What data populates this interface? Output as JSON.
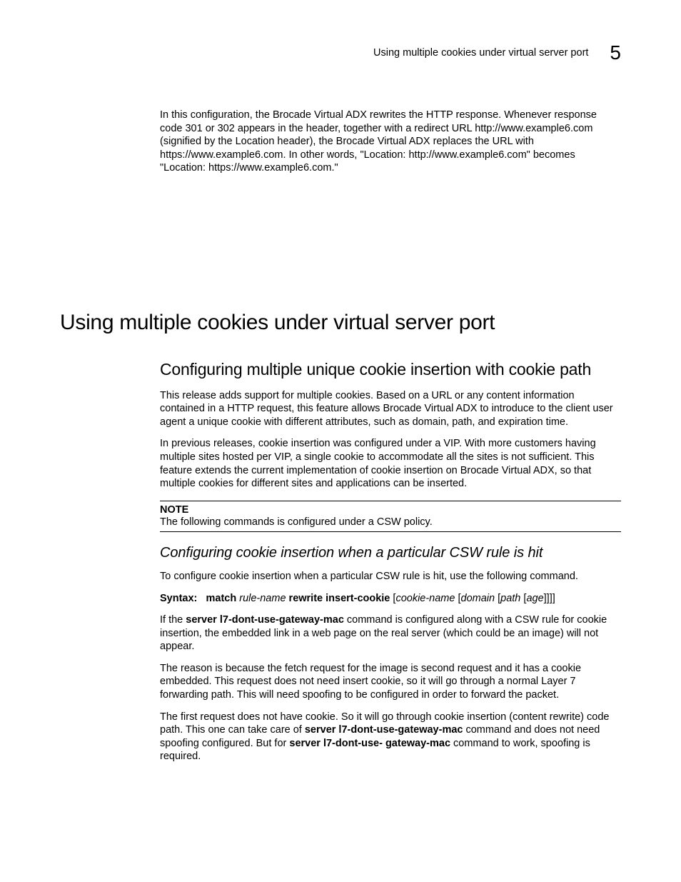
{
  "header": {
    "running_title": "Using multiple cookies under virtual server port",
    "chapter_number": "5"
  },
  "intro_para": "In this configuration, the Brocade Virtual ADX rewrites the HTTP response. Whenever response code 301 or 302 appears in the header, together with a redirect URL http://www.example6.com (signified by the Location header), the Brocade Virtual ADX replaces the URL with https://www.example6.com. In other words, \"Location: http://www.example6.com\" becomes \"Location: https://www.example6.com.\"",
  "h1": "Using multiple cookies under virtual server port",
  "h2": "Configuring multiple unique cookie insertion with cookie path",
  "p1": "This release adds support for multiple cookies. Based on a URL or any content information contained in a HTTP request, this feature allows Brocade Virtual ADX to introduce to the client user agent a unique cookie with different attributes, such as domain, path, and expiration time.",
  "p2": "In previous releases, cookie insertion was configured under a VIP. With more customers having multiple sites hosted per VIP, a single cookie to accommodate all the sites is not sufficient. This feature extends the current implementation of cookie insertion on Brocade Virtual ADX, so that multiple cookies for different sites and applications can be inserted.",
  "note": {
    "label": "NOTE",
    "text": "The following commands is configured under a CSW policy."
  },
  "h3": "Configuring cookie insertion when a particular CSW rule is hit",
  "p3": "To configure cookie insertion when a particular CSW rule is hit, use the following command.",
  "syntax": {
    "label": "Syntax:",
    "kw1": "match",
    "arg1": "rule-name",
    "kw2": "rewrite insert-cookie",
    "tail_open": " [",
    "arg2": "cookie-name",
    "tail_mid1": " [",
    "arg3": "domain",
    "tail_mid2": " [",
    "arg4": "path",
    "tail_mid3": " [",
    "arg5": "age",
    "tail_close": "]]]]"
  },
  "p4_pre": "If the ",
  "p4_cmd": "server l7-dont-use-gateway-mac",
  "p4_post": " command is configured along with a CSW rule for cookie insertion, the embedded link in a web page on the real server (which could be an image) will not appear.",
  "p5": "The reason is because the fetch request for the image is second request and it has a cookie embedded. This request does not need insert cookie, so it will go through a normal Layer 7 forwarding path. This will need spoofing to be configured in order to forward the packet.",
  "p6_a": "The first request does not have cookie. So it will go through cookie insertion (content rewrite) code path. This one can take care of ",
  "p6_cmd1": "server l7-dont-use-gateway-mac",
  "p6_b": " command and does not need spoofing configured. But for ",
  "p6_cmd2": "server l7-dont-use- gateway-mac",
  "p6_c": " command to work, spoofing is required."
}
